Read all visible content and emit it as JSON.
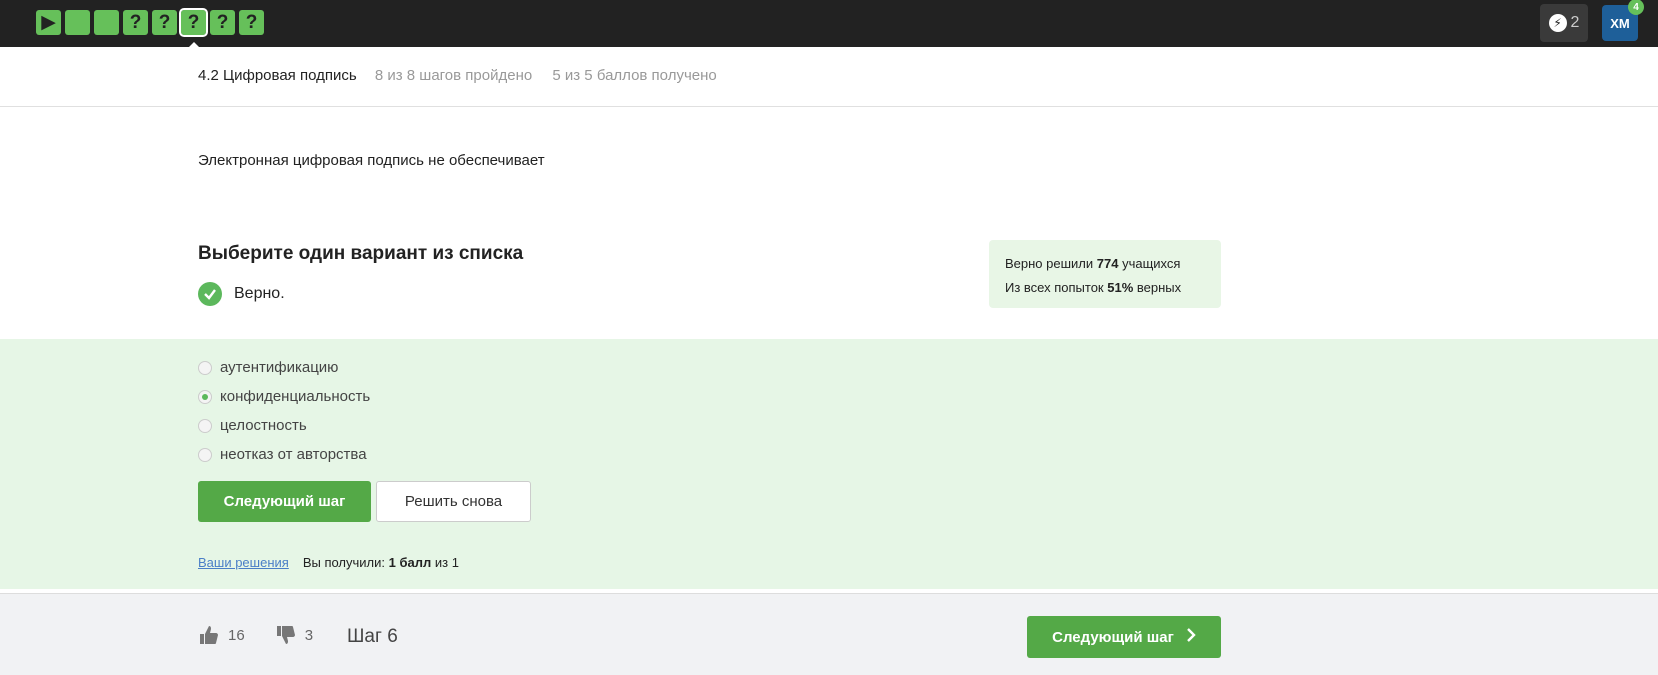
{
  "topbar": {
    "steps": [
      {
        "glyph": "▶",
        "state": "play"
      },
      {
        "glyph": "",
        "state": "done"
      },
      {
        "glyph": "",
        "state": "done"
      },
      {
        "glyph": "?",
        "state": "quiz"
      },
      {
        "glyph": "?",
        "state": "quiz"
      },
      {
        "glyph": "?",
        "state": "current"
      },
      {
        "glyph": "?",
        "state": "quiz"
      },
      {
        "glyph": "?",
        "state": "quiz"
      }
    ],
    "energy_count": "2",
    "avatar_initials": "XM",
    "notification_count": "4"
  },
  "lesson": {
    "title": "4.2 Цифровая подпись",
    "steps_progress": "8 из 8 шагов пройдено",
    "points_progress": "5 из 5 баллов  получено"
  },
  "question": {
    "text": "Электронная цифровая подпись не обеспечивает",
    "choose_title": "Выберите один вариант из списка",
    "verdict": "Верно."
  },
  "stats": {
    "solved_prefix": "Верно решили ",
    "solved_count": "774",
    "solved_suffix": " учащихся",
    "attempts_prefix": "Из всех попыток ",
    "attempts_percent": "51%",
    "attempts_suffix": " верных"
  },
  "options": [
    {
      "label": "аутентификацию",
      "checked": false
    },
    {
      "label": "конфиденциальность",
      "checked": true
    },
    {
      "label": "целостность",
      "checked": false
    },
    {
      "label": "неотказ от авторства",
      "checked": false
    }
  ],
  "buttons": {
    "next_step": "Следующий шаг",
    "retry": "Решить снова"
  },
  "solutions": {
    "link": "Ваши решения",
    "got_prefix": "Вы получили: ",
    "got_points": "1 балл",
    "got_suffix": " из 1"
  },
  "footer": {
    "likes": "16",
    "dislikes": "3",
    "step_label": "Шаг 6",
    "next_button": "Следующий шаг"
  },
  "colors": {
    "accent_green": "#54a947",
    "topbar_bg": "#222222",
    "answers_bg": "#e6f6e6"
  }
}
